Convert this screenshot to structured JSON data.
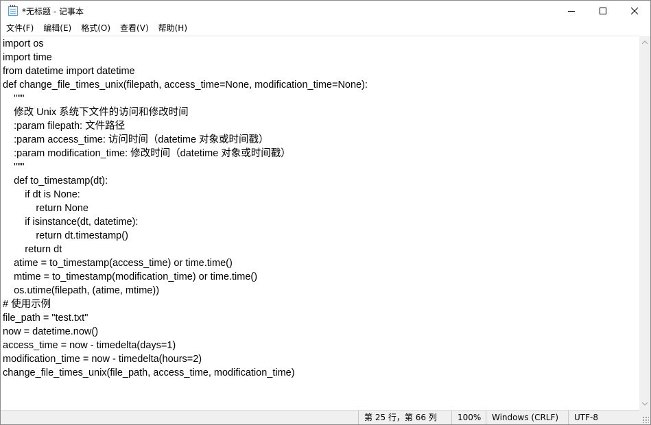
{
  "window": {
    "title": "*无标题 - 记事本"
  },
  "menu": {
    "items": [
      "文件(F)",
      "编辑(E)",
      "格式(O)",
      "查看(V)",
      "帮助(H)"
    ]
  },
  "editor": {
    "content": "import os\nimport time\nfrom datetime import datetime\ndef change_file_times_unix(filepath, access_time=None, modification_time=None):\n    \"\"\"\n    修改 Unix 系统下文件的访问和修改时间\n    :param filepath: 文件路径\n    :param access_time: 访问时间（datetime 对象或时间戳）\n    :param modification_time: 修改时间（datetime 对象或时间戳）\n    \"\"\"\n    def to_timestamp(dt):\n        if dt is None:\n            return None\n        if isinstance(dt, datetime):\n            return dt.timestamp()\n        return dt\n    atime = to_timestamp(access_time) or time.time()\n    mtime = to_timestamp(modification_time) or time.time()\n    os.utime(filepath, (atime, mtime))\n# 使用示例\nfile_path = \"test.txt\"\nnow = datetime.now()\naccess_time = now - timedelta(days=1)\nmodification_time = now - timedelta(hours=2)\nchange_file_times_unix(file_path, access_time, modification_time)"
  },
  "statusbar": {
    "position": "第 25 行，第 66 列",
    "zoom": "100%",
    "line_ending": "Windows (CRLF)",
    "encoding": "UTF-8"
  },
  "icons": {
    "app": "notepad-icon",
    "minimize": "minimize-icon",
    "maximize": "maximize-icon",
    "close": "close-icon"
  }
}
